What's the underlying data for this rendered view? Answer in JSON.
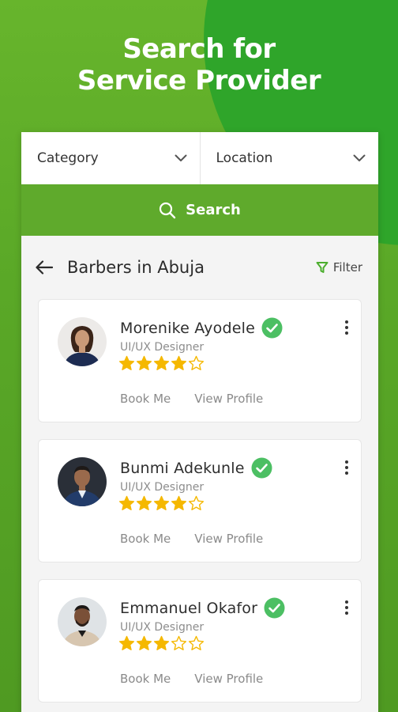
{
  "headline": {
    "line1": "Search for",
    "line2": "Service Provider"
  },
  "filters": {
    "category_label": "Category",
    "location_label": "Location"
  },
  "search": {
    "label": "Search"
  },
  "list": {
    "title": "Barbers in Abuja",
    "filter_label": "Filter"
  },
  "colors": {
    "brand_green": "#5faa2c",
    "verified_green": "#4cbf63",
    "star_gold": "#f5b800"
  },
  "providers": [
    {
      "name": "Morenike Ayodele",
      "role": "UI/UX Designer",
      "rating": 4,
      "max_rating": 5,
      "book_label": "Book Me",
      "profile_label": "View Profile"
    },
    {
      "name": "Bunmi Adekunle",
      "role": "UI/UX Designer",
      "rating": 4,
      "max_rating": 5,
      "book_label": "Book Me",
      "profile_label": "View Profile"
    },
    {
      "name": "Emmanuel Okafor",
      "role": "UI/UX Designer",
      "rating": 3,
      "max_rating": 5,
      "book_label": "Book Me",
      "profile_label": "View Profile"
    }
  ]
}
